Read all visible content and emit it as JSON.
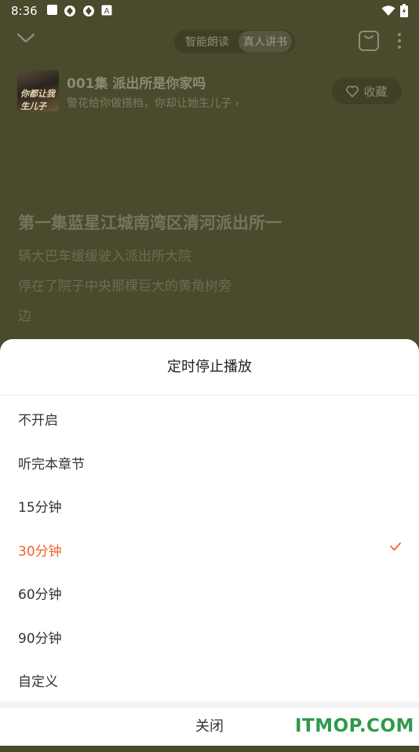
{
  "status_bar": {
    "time": "8:36",
    "notif_badge": "A"
  },
  "top_bar": {
    "tabs": [
      "智能朗读",
      "真人讲书"
    ]
  },
  "book": {
    "cover_text": "你都让我生儿子",
    "chapter_title": "001集 派出所是你家吗",
    "chapter_sub": "警花给你做搭档，你却让她生儿子",
    "sub_arrow": "›",
    "collect_label": "收藏"
  },
  "reader": {
    "heading": "第一集蓝星江城南湾区清河派出所一",
    "lines": [
      "辆大巴车缓缓驶入派出所大院",
      "停在了院子中央那棵巨大的黄角树旁",
      "边"
    ]
  },
  "sheet": {
    "title": "定时停止播放",
    "options": [
      "不开启",
      "听完本章节",
      "15分钟",
      "30分钟",
      "60分钟",
      "90分钟",
      "自定义"
    ],
    "selected_index": 3,
    "close_label": "关闭"
  },
  "watermark": "ITMOP.COM",
  "colors": {
    "accent": "#f0642a",
    "background": "#4a4a2c",
    "watermark": "#2f9a4a"
  }
}
